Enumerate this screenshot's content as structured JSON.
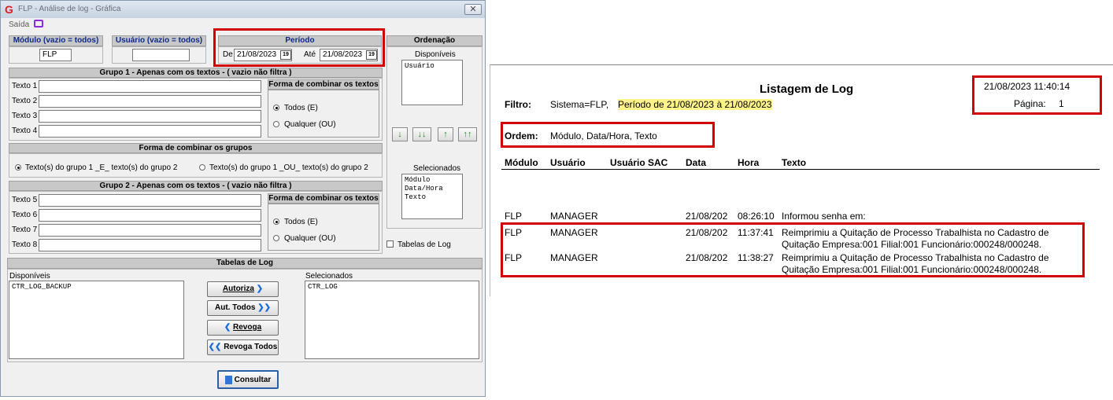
{
  "window": {
    "title": "FLP - Análise de log - Gráfica",
    "close_label": "✕",
    "menu_saida": "Saída"
  },
  "modulo": {
    "header": "Módulo (vazio = todos)",
    "value": "FLP"
  },
  "usuario": {
    "header": "Usuário (vazio = todos)",
    "value": ""
  },
  "periodo": {
    "header": "Período",
    "de_label": "De",
    "de_value": "21/08/2023",
    "ate_label": "Até",
    "ate_value": "21/08/2023",
    "calendar_label": "19"
  },
  "ordenacao": {
    "header": "Ordenação",
    "disponiveis_label": "Disponíveis",
    "disponiveis_items": [
      "Usuário"
    ],
    "selecionados_label": "Selecionados",
    "selecionados_items": [
      "Módulo",
      "Data/Hora",
      "Texto"
    ],
    "buttons": [
      "↓",
      "↓↓",
      "↑",
      "↑↑"
    ]
  },
  "grupo1": {
    "header": "Grupo 1 - Apenas com os textos - ( vazio não filtra )",
    "labels": [
      "Texto 1",
      "Texto 2",
      "Texto 3",
      "Texto 4"
    ],
    "combinar_header": "Forma de combinar os textos",
    "opt_todos": "Todos (E)",
    "opt_qualquer": "Qualquer (OU)"
  },
  "grupos": {
    "header": "Forma de combinar os grupos",
    "opt_e": "Texto(s) do grupo 1 _E_ texto(s) do grupo 2",
    "opt_ou": "Texto(s) do grupo 1 _OU_ texto(s) do grupo 2"
  },
  "grupo2": {
    "header": "Grupo 2 - Apenas com os textos - ( vazio não filtra )",
    "labels": [
      "Texto 5",
      "Texto 6",
      "Texto 7",
      "Texto 8"
    ],
    "combinar_header": "Forma de combinar os textos",
    "opt_todos": "Todos (E)",
    "opt_qualquer": "Qualquer (OU)"
  },
  "tabelas_log_check": "Tabelas de Log",
  "tabelas": {
    "header": "Tabelas de Log",
    "disponiveis_label": "Disponíveis",
    "disponiveis_items": [
      "CTR_LOG_BACKUP"
    ],
    "selecionados_label": "Selecionados",
    "selecionados_items": [
      "CTR_LOG"
    ],
    "btn_autoriza": "Autoriza",
    "btn_aut_todos": "Aut. Todos",
    "btn_revoga": "Revoga",
    "btn_revoga_todos": "Revoga Todos"
  },
  "consultar_label": "Consultar",
  "report": {
    "title": "Listagem de Log",
    "datetime": "21/08/2023 11:40:14",
    "pagina_label": "Página:",
    "pagina_value": "1",
    "filtro_label": "Filtro:",
    "filtro_sistema": "Sistema=FLP,",
    "filtro_periodo": "Período de 21/08/2023 à 21/08/2023",
    "ordem_label": "Ordem:",
    "ordem_value": "Módulo, Data/Hora, Texto",
    "columns": [
      "Módulo",
      "Usuário",
      "Usuário SAC",
      "Data",
      "Hora",
      "Texto"
    ],
    "rows": [
      {
        "modulo": "FLP",
        "usuario": "MANAGER",
        "data": "21/08/202",
        "hora": "08:26:10",
        "texto1": "Informou  senha  em:",
        "texto2": ""
      },
      {
        "modulo": "FLP",
        "usuario": "MANAGER",
        "data": "21/08/202",
        "hora": "11:37:41",
        "texto1": "Reimprimiu a Quitação de Processo Trabalhista no Cadastro de",
        "texto2": "Quitação Empresa:001 Filial:001 Funcionário:000248/000248."
      },
      {
        "modulo": "FLP",
        "usuario": "MANAGER",
        "data": "21/08/202",
        "hora": "11:38:27",
        "texto1": "Reimprimiu a Quitação de Processo Trabalhista no Cadastro de",
        "texto2": "Quitação Empresa:001 Filial:001 Funcionário:000248/000248."
      }
    ]
  }
}
